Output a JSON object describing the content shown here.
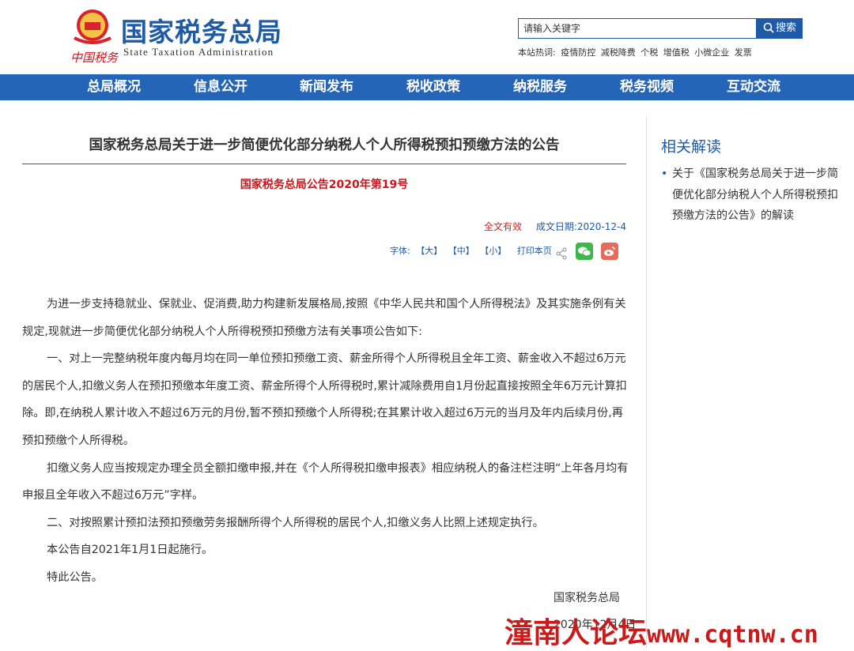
{
  "header": {
    "brand_cn": "国家税务总局",
    "brand_en": "State Taxation Administration",
    "brand_sub": "中国税务",
    "search_placeholder": "请输入关键字",
    "search_button": "搜索",
    "hot_label": "本站热词:",
    "hot_words": [
      "疫情防控",
      "减税降费",
      "个税",
      "增值税",
      "小微企业",
      "发票"
    ]
  },
  "nav": {
    "items": [
      "总局概况",
      "信息公开",
      "新闻发布",
      "税收政策",
      "纳税服务",
      "税务视频",
      "互动交流"
    ]
  },
  "article": {
    "title": "国家税务总局关于进一步简便优化部分纳税人个人所得税预扣预缴方法的公告",
    "doc_no": "国家税务总局公告2020年第19号",
    "validity": "全文有效",
    "date": "成文日期:2020-12-4",
    "font_label": "字体:",
    "font_large": "【大】",
    "font_medium": "【中】",
    "font_small": "【小】",
    "print_label": "打印本页",
    "paragraphs": [
      "为进一步支持稳就业、保就业、促消费,助力构建新发展格局,按照《中华人民共和国个人所得税法》及其实施条例有关规定,现就进一步简便优化部分纳税人个人所得税预扣预缴方法有关事项公告如下:",
      "一、对上一完整纳税年度内每月均在同一单位预扣预缴工资、薪金所得个人所得税且全年工资、薪金收入不超过6万元的居民个人,扣缴义务人在预扣预缴本年度工资、薪金所得个人所得税时,累计减除费用自1月份起直接按照全年6万元计算扣除。即,在纳税人累计收入不超过6万元的月份,暂不预扣预缴个人所得税;在其累计收入超过6万元的当月及年内后续月份,再预扣预缴个人所得税。",
      "扣缴义务人应当按规定办理全员全额扣缴申报,并在《个人所得税扣缴申报表》相应纳税人的备注栏注明“上年各月均有申报且全年收入不超过6万元”字样。",
      "二、对按照累计预扣法预扣预缴劳务报酬所得个人所得税的居民个人,扣缴义务人比照上述规定执行。",
      "本公告自2021年1月1日起施行。",
      "特此公告。"
    ],
    "signature": "国家税务总局",
    "sign_date": "2020年12月4日"
  },
  "sidebar": {
    "title": "相关解读",
    "items": [
      "关于《国家税务总局关于进一步简便优化部分纳税人个人所得税预扣预缴方法的公告》的解读"
    ]
  },
  "watermark": {
    "text": "潼南人论坛",
    "url": "www.cqtnw.cn"
  },
  "colors": {
    "brand_blue": "#1f5aa6",
    "nav_blue": "#2565b8",
    "accent_red": "#c8161d"
  }
}
